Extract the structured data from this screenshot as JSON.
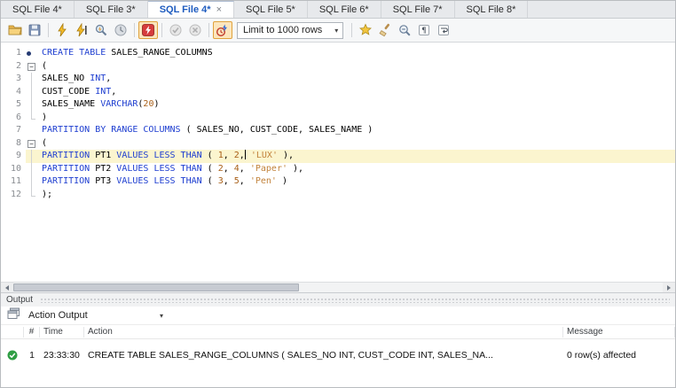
{
  "tabs": {
    "items": [
      {
        "label": "SQL File 4*",
        "active": false
      },
      {
        "label": "SQL File 3*",
        "active": false
      },
      {
        "label": "SQL File 4*",
        "active": true,
        "closable": true
      },
      {
        "label": "SQL File 5*",
        "active": false
      },
      {
        "label": "SQL File 6*",
        "active": false
      },
      {
        "label": "SQL File 7*",
        "active": false
      },
      {
        "label": "SQL File 8*",
        "active": false
      }
    ]
  },
  "toolbar": {
    "items": [
      {
        "type": "icon",
        "name": "open-file-icon"
      },
      {
        "type": "icon",
        "name": "save-icon"
      },
      {
        "type": "sep"
      },
      {
        "type": "icon",
        "name": "execute-icon"
      },
      {
        "type": "icon",
        "name": "execute-current-statement-icon"
      },
      {
        "type": "icon",
        "name": "explain-query-icon"
      },
      {
        "type": "icon",
        "name": "stop-query-icon"
      },
      {
        "type": "sep"
      },
      {
        "type": "icon",
        "name": "toggle-stop-on-error-icon",
        "state": "pressed"
      },
      {
        "type": "sep"
      },
      {
        "type": "icon",
        "name": "commit-icon",
        "state": "disabled"
      },
      {
        "type": "icon",
        "name": "rollback-icon",
        "state": "disabled"
      },
      {
        "type": "sep"
      },
      {
        "type": "icon",
        "name": "toggle-autocommit-icon",
        "state": "pressed"
      },
      {
        "type": "dropdown",
        "label": "Limit to 1000 rows"
      },
      {
        "type": "sep"
      },
      {
        "type": "icon",
        "name": "save-snippet-icon"
      },
      {
        "type": "icon",
        "name": "beautify-script-icon"
      },
      {
        "type": "icon",
        "name": "find-icon"
      },
      {
        "type": "icon",
        "name": "invisible-characters-icon"
      },
      {
        "type": "icon",
        "name": "wrap-text-icon"
      }
    ]
  },
  "editor": {
    "lines": [
      {
        "num": "1",
        "marker": "dot",
        "fold": "",
        "current": false,
        "segs": [
          [
            "k",
            "CREATE"
          ],
          [
            "p",
            " "
          ],
          [
            "k",
            "TABLE"
          ],
          [
            "p",
            " SALES_RANGE_COLUMNS"
          ]
        ]
      },
      {
        "num": "2",
        "marker": "",
        "fold": "box",
        "current": false,
        "segs": [
          [
            "p",
            "("
          ]
        ]
      },
      {
        "num": "3",
        "marker": "",
        "fold": "v",
        "current": false,
        "segs": [
          [
            "p",
            "SALES_NO "
          ],
          [
            "k",
            "INT"
          ],
          [
            "p",
            ","
          ]
        ]
      },
      {
        "num": "4",
        "marker": "",
        "fold": "v",
        "current": false,
        "segs": [
          [
            "p",
            "CUST_CODE "
          ],
          [
            "k",
            "INT"
          ],
          [
            "p",
            ","
          ]
        ]
      },
      {
        "num": "5",
        "marker": "",
        "fold": "v",
        "current": false,
        "segs": [
          [
            "p",
            "SALES_NAME "
          ],
          [
            "k",
            "VARCHAR"
          ],
          [
            "p",
            "("
          ],
          [
            "n",
            "20"
          ],
          [
            "p",
            ")"
          ]
        ]
      },
      {
        "num": "6",
        "marker": "",
        "fold": "end",
        "current": false,
        "segs": [
          [
            "p",
            ")"
          ]
        ]
      },
      {
        "num": "7",
        "marker": "",
        "fold": "",
        "current": false,
        "segs": [
          [
            "k",
            "PARTITION BY RANGE COLUMNS"
          ],
          [
            "p",
            " ( SALES_NO, CUST_CODE, SALES_NAME )"
          ]
        ]
      },
      {
        "num": "8",
        "marker": "",
        "fold": "box",
        "current": false,
        "segs": [
          [
            "p",
            "("
          ]
        ]
      },
      {
        "num": "9",
        "marker": "",
        "fold": "v",
        "current": true,
        "segs": [
          [
            "k",
            "PARTITION"
          ],
          [
            "p",
            " PT1 "
          ],
          [
            "k",
            "VALUES LESS THAN"
          ],
          [
            "p",
            " ( "
          ],
          [
            "n",
            "1"
          ],
          [
            "p",
            ", "
          ],
          [
            "n",
            "2"
          ],
          [
            "p",
            ","
          ],
          [
            "cur",
            ""
          ],
          [
            "p",
            " "
          ],
          [
            "s",
            "'LUX'"
          ],
          [
            "p",
            " ),"
          ]
        ]
      },
      {
        "num": "10",
        "marker": "",
        "fold": "v",
        "current": false,
        "segs": [
          [
            "k",
            "PARTITION"
          ],
          [
            "p",
            " PT2 "
          ],
          [
            "k",
            "VALUES LESS THAN"
          ],
          [
            "p",
            " ( "
          ],
          [
            "n",
            "2"
          ],
          [
            "p",
            ", "
          ],
          [
            "n",
            "4"
          ],
          [
            "p",
            ", "
          ],
          [
            "s",
            "'Paper'"
          ],
          [
            "p",
            " ),"
          ]
        ]
      },
      {
        "num": "11",
        "marker": "",
        "fold": "v",
        "current": false,
        "segs": [
          [
            "k",
            "PARTITION"
          ],
          [
            "p",
            " PT3 "
          ],
          [
            "k",
            "VALUES LESS THAN"
          ],
          [
            "p",
            " ( "
          ],
          [
            "n",
            "3"
          ],
          [
            "p",
            ", "
          ],
          [
            "n",
            "5"
          ],
          [
            "p",
            ", "
          ],
          [
            "s",
            "'Pen'"
          ],
          [
            "p",
            " )"
          ]
        ]
      },
      {
        "num": "12",
        "marker": "",
        "fold": "end",
        "current": false,
        "segs": [
          [
            "p",
            ");"
          ]
        ]
      }
    ]
  },
  "output": {
    "title": "Output",
    "view_selector": "Action Output",
    "columns": [
      "#",
      "Time",
      "Action",
      "Message"
    ],
    "rows": [
      {
        "status": "success",
        "index": "1",
        "time": "23:33:30",
        "action": "CREATE TABLE SALES_RANGE_COLUMNS ( SALES_NO INT, CUST_CODE INT, SALES_NA...",
        "message": "0 row(s) affected"
      }
    ]
  },
  "colors": {
    "keyword": "#1e3ed0",
    "plain": "#000000",
    "number": "#a85f17",
    "string": "#c2833c",
    "current_line": "#fbf5cf",
    "tab_active_text": "#1d5bbf",
    "success": "#2f9e44"
  }
}
